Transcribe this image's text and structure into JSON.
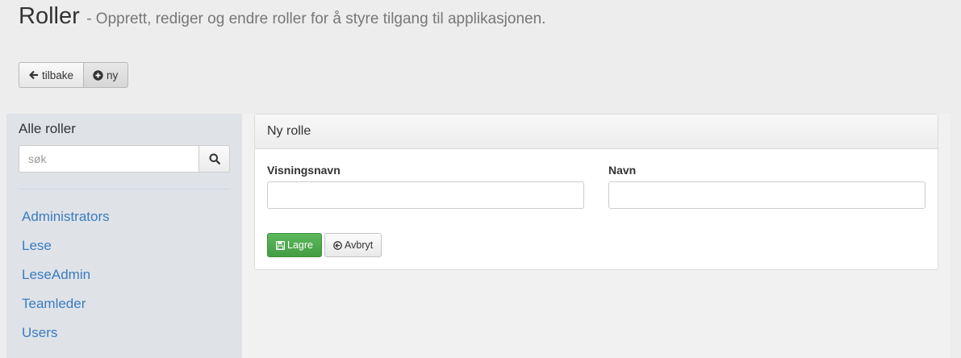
{
  "header": {
    "title": "Roller",
    "subtitle": "- Opprett, rediger og endre roller for å styre tilgang til applikasjonen."
  },
  "toolbar": {
    "back_label": "tilbake",
    "back_icon": "arrow-left-icon",
    "new_label": "ny",
    "new_icon": "plus-circle-icon"
  },
  "sidebar": {
    "title": "Alle roller",
    "search": {
      "placeholder": "søk",
      "value": "",
      "icon": "search-icon"
    },
    "roles": [
      "Administrators",
      "Lese",
      "LeseAdmin",
      "Teamleder",
      "Users"
    ]
  },
  "panel": {
    "title": "Ny rolle",
    "fields": {
      "display_name": {
        "label": "Visningsnavn",
        "value": ""
      },
      "name": {
        "label": "Navn",
        "value": ""
      }
    },
    "save_label": "Lagre",
    "save_icon": "floppy-disk-icon",
    "cancel_label": "Avbryt",
    "cancel_icon": "circle-arrow-left-icon"
  },
  "colors": {
    "link": "#3a7bbf",
    "success": "#5cb85c",
    "sidebar_bg": "#dfe3e8",
    "page_bg": "#ededed"
  }
}
